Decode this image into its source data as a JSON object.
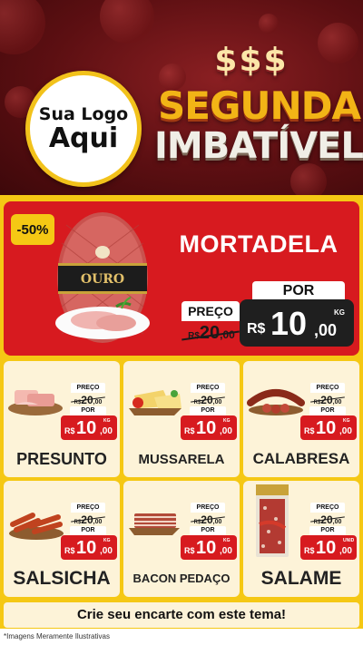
{
  "header": {
    "logo_line1": "Sua Logo",
    "logo_line2": "Aqui",
    "dollar_signs": "$$$",
    "title_line1": "SEGUNDA",
    "title_line2": "IMBATÍVEL"
  },
  "featured": {
    "discount_badge": "-50%",
    "name": "MORTADELA",
    "package_brand": "OURO",
    "preco_label": "PREÇO",
    "old_currency": "R$",
    "old_price_int": "20",
    "old_price_cents": ",00",
    "por_label": "POR",
    "new_currency": "R$",
    "new_price_int": "10",
    "new_price_cents": ",00",
    "unit": "KG"
  },
  "products": [
    {
      "name": "PRESUNTO",
      "preco_label": "PREÇO",
      "old_currency": "R$",
      "old_int": "20",
      "old_cents": ",00",
      "por_label": "POR",
      "new_currency": "R$",
      "new_int": "10",
      "new_cents": ",00",
      "unit": "KG"
    },
    {
      "name": "MUSSARELA",
      "preco_label": "PREÇO",
      "old_currency": "R$",
      "old_int": "20",
      "old_cents": ",00",
      "por_label": "POR",
      "new_currency": "R$",
      "new_int": "10",
      "new_cents": ",00",
      "unit": "KG"
    },
    {
      "name": "CALABRESA",
      "preco_label": "PREÇO",
      "old_currency": "R$",
      "old_int": "20",
      "old_cents": ",00",
      "por_label": "POR",
      "new_currency": "R$",
      "new_int": "10",
      "new_cents": ",00",
      "unit": "KG"
    },
    {
      "name": "SALSICHA",
      "preco_label": "PREÇO",
      "old_currency": "R$",
      "old_int": "20",
      "old_cents": ",00",
      "por_label": "POR",
      "new_currency": "R$",
      "new_int": "10",
      "new_cents": ",00",
      "unit": "KG"
    },
    {
      "name": "BACON PEDAÇO",
      "preco_label": "PREÇO",
      "old_currency": "R$",
      "old_int": "20",
      "old_cents": ",00",
      "por_label": "POR",
      "new_currency": "R$",
      "new_int": "10",
      "new_cents": ",00",
      "unit": "KG"
    },
    {
      "name": "SALAME",
      "preco_label": "PREÇO",
      "old_currency": "R$",
      "old_int": "20",
      "old_cents": ",00",
      "por_label": "POR",
      "new_currency": "R$",
      "new_int": "10",
      "new_cents": ",00",
      "unit": "UNID"
    }
  ],
  "banner": "Crie seu encarte com este tema!",
  "footnote": "*Imagens Meramente Ilustrativas",
  "colors": {
    "red": "#d71a1f",
    "yellow": "#f5c814",
    "maroon": "#5c0f12",
    "gold": "#f2b416",
    "card_bg": "#fdf3d8"
  }
}
